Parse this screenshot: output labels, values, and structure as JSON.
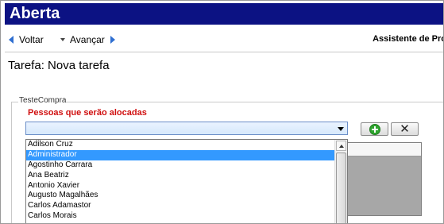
{
  "window": {
    "title": "Aberta"
  },
  "nav": {
    "back_label": "Voltar",
    "forward_label": "Avançar",
    "assistant_label": "Assistente de Pro"
  },
  "task": {
    "title": "Tarefa: Nova tarefa"
  },
  "group": {
    "legend": "TesteCompra",
    "people_label": "Pessoas que serão alocadas"
  },
  "combo": {
    "value": ""
  },
  "buttons": {
    "add_icon": "plus-circle-icon",
    "remove_icon": "x-icon",
    "remove_glyph": "✕"
  },
  "dropdown": {
    "items": [
      "Adilson Cruz",
      "Administrador",
      "Agostinho Carrara",
      "Ana Beatriz",
      "Antonio Xavier",
      "Augusto Magalhães",
      "Carlos Adamastor",
      "Carlos Morais"
    ],
    "selected": "Administrador"
  },
  "colors": {
    "titlebar": "#0c1283",
    "accent_red": "#d01010",
    "selection": "#3399ff"
  }
}
